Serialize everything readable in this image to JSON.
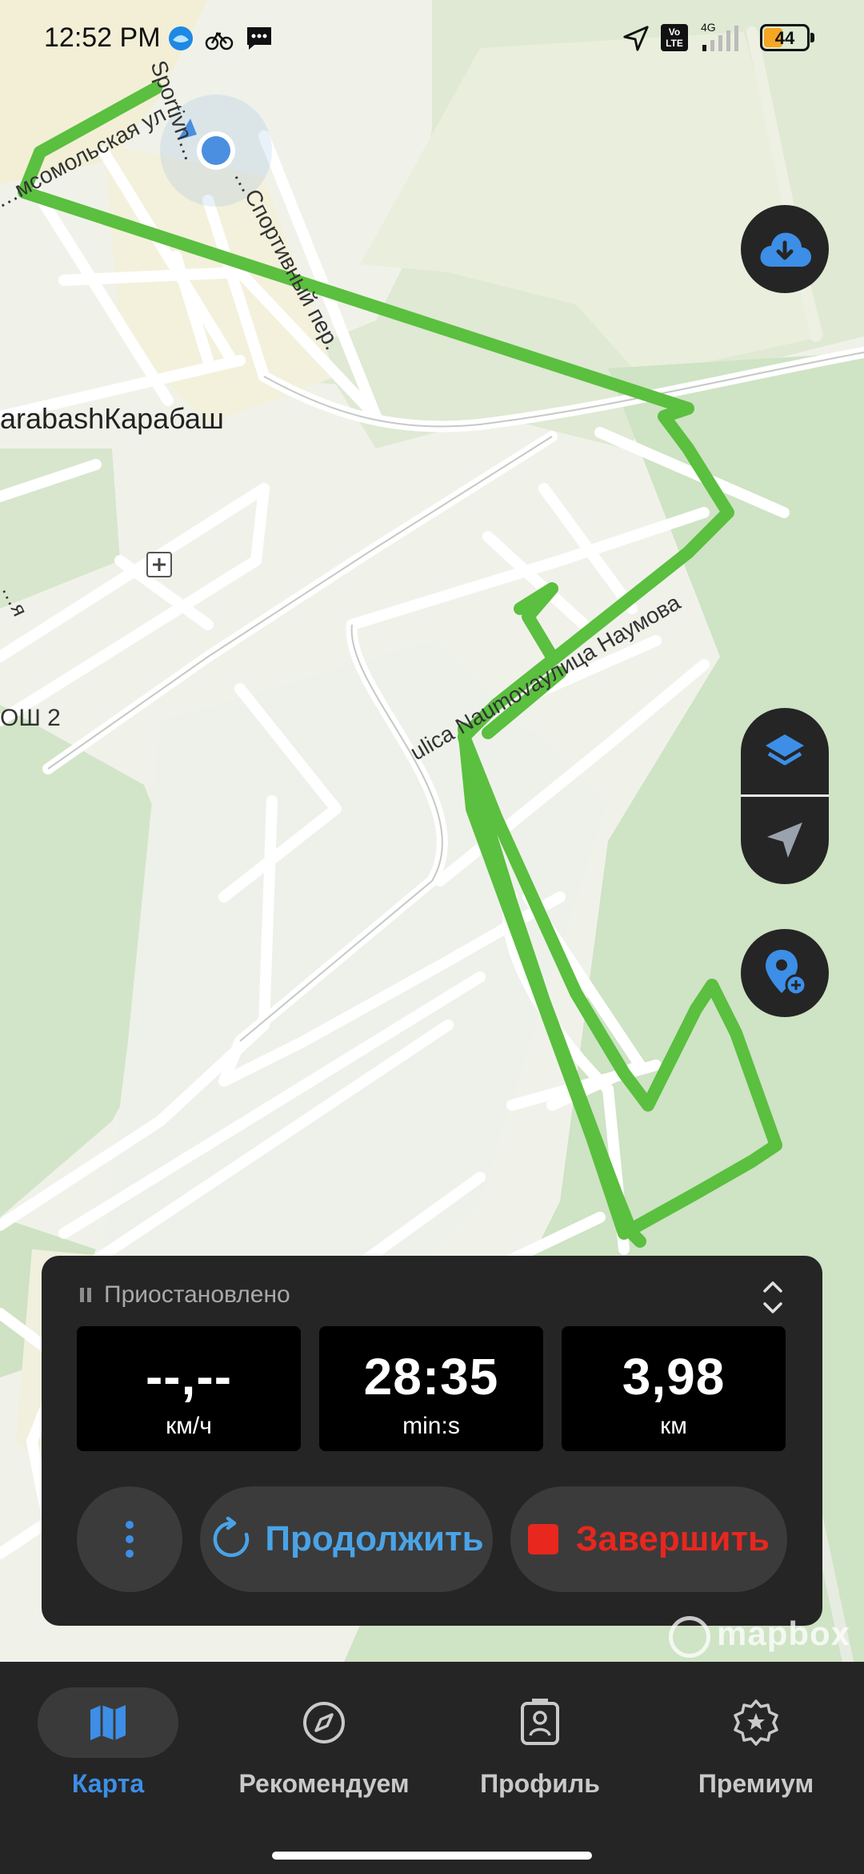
{
  "status_bar": {
    "time": "12:52 PM",
    "battery": "44",
    "battery_level": 0.44,
    "network": "4G",
    "volte": "Vo LTE"
  },
  "map": {
    "labels": {
      "street_1": "…мсомольская ул.",
      "street_2": "Sportivn…",
      "street_3": "…Спортивный пер.",
      "town": "arabashКарабаш",
      "street_4": "ulica Naumovaулица Наумова",
      "school": "ОШ 2",
      "left_edge": "…я"
    },
    "track_color": "#5bbf3f",
    "location_color": "#4a8fe0"
  },
  "map_controls": {
    "download": "cloud-download-icon",
    "layers": "layers-icon",
    "locate": "navigation-arrow-icon",
    "add_place": "add-location-icon"
  },
  "tracking_panel": {
    "status": "Приостановлено",
    "stats": [
      {
        "value": "--,--",
        "unit": "км/ч"
      },
      {
        "value": "28:35",
        "unit": "min:s"
      },
      {
        "value": "3,98",
        "unit": "км"
      }
    ],
    "resume_label": "Продолжить",
    "finish_label": "Завершить",
    "resume_color": "#4aa3e6",
    "finish_color": "#e8271e"
  },
  "attribution": "mapbox",
  "bottom_nav": {
    "items": [
      {
        "label": "Карта",
        "icon": "map-icon",
        "active": true
      },
      {
        "label": "Рекомендуем",
        "icon": "compass-icon",
        "active": false
      },
      {
        "label": "Профиль",
        "icon": "profile-icon",
        "active": false
      },
      {
        "label": "Премиум",
        "icon": "premium-star-icon",
        "active": false
      }
    ],
    "active_color": "#3d8ee6"
  }
}
